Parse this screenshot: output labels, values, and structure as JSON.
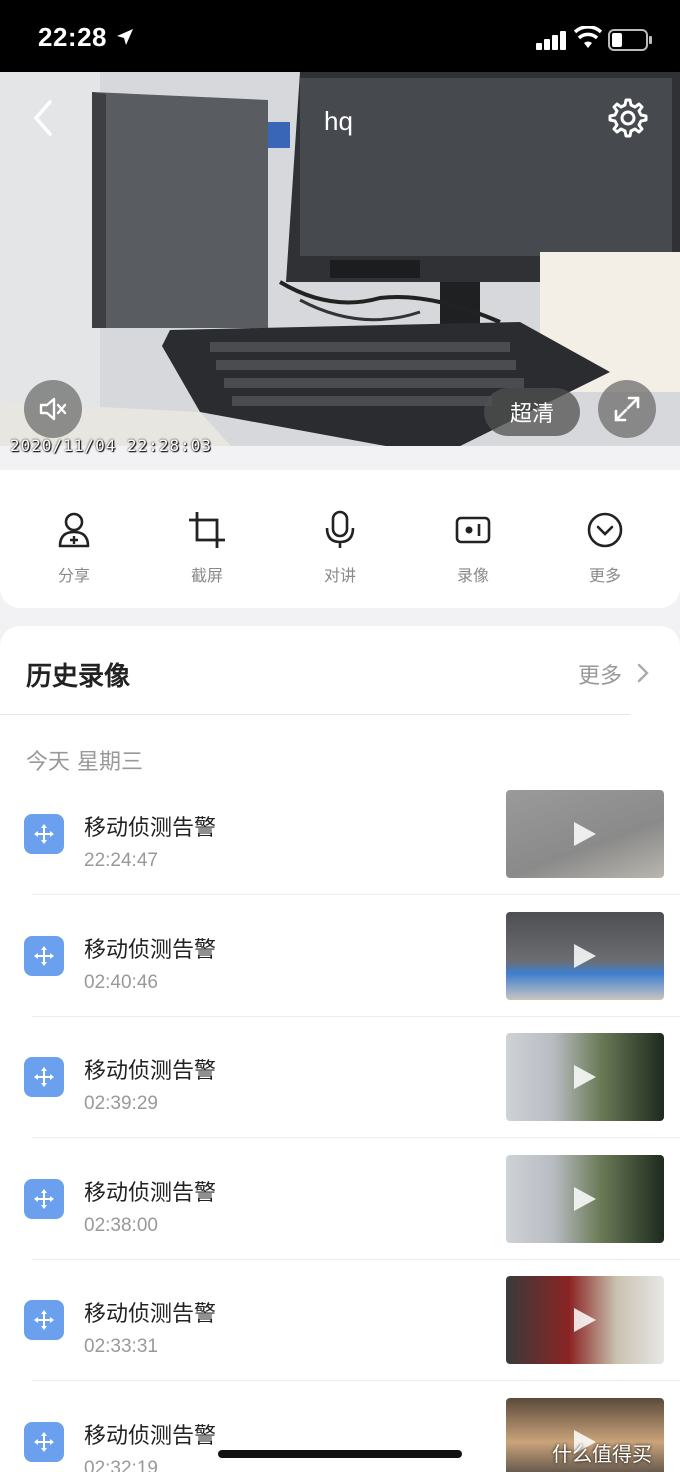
{
  "status_bar": {
    "time": "22:28"
  },
  "camera": {
    "name": "hq",
    "quality_label": "超清",
    "timestamp": "2020/11/04 22:28:03"
  },
  "toolbar": {
    "items": [
      {
        "label": "分享",
        "icon": "share-user-icon"
      },
      {
        "label": "截屏",
        "icon": "crop-icon"
      },
      {
        "label": "对讲",
        "icon": "microphone-icon"
      },
      {
        "label": "录像",
        "icon": "video-record-icon"
      },
      {
        "label": "更多",
        "icon": "chevron-down-circle-icon"
      }
    ]
  },
  "history": {
    "title": "历史录像",
    "more_label": "更多",
    "day_label": "今天 星期三",
    "events": [
      {
        "title": "移动侦测告警",
        "time": "22:24:47"
      },
      {
        "title": "移动侦测告警",
        "time": "02:40:46"
      },
      {
        "title": "移动侦测告警",
        "time": "02:39:29"
      },
      {
        "title": "移动侦测告警",
        "time": "02:38:00"
      },
      {
        "title": "移动侦测告警",
        "time": "02:33:31"
      },
      {
        "title": "移动侦测告警",
        "time": "02:32:19"
      }
    ]
  },
  "watermark": "什么值得买",
  "colors": {
    "accent": "#6aa0ee",
    "background": "#f2f2f4"
  }
}
